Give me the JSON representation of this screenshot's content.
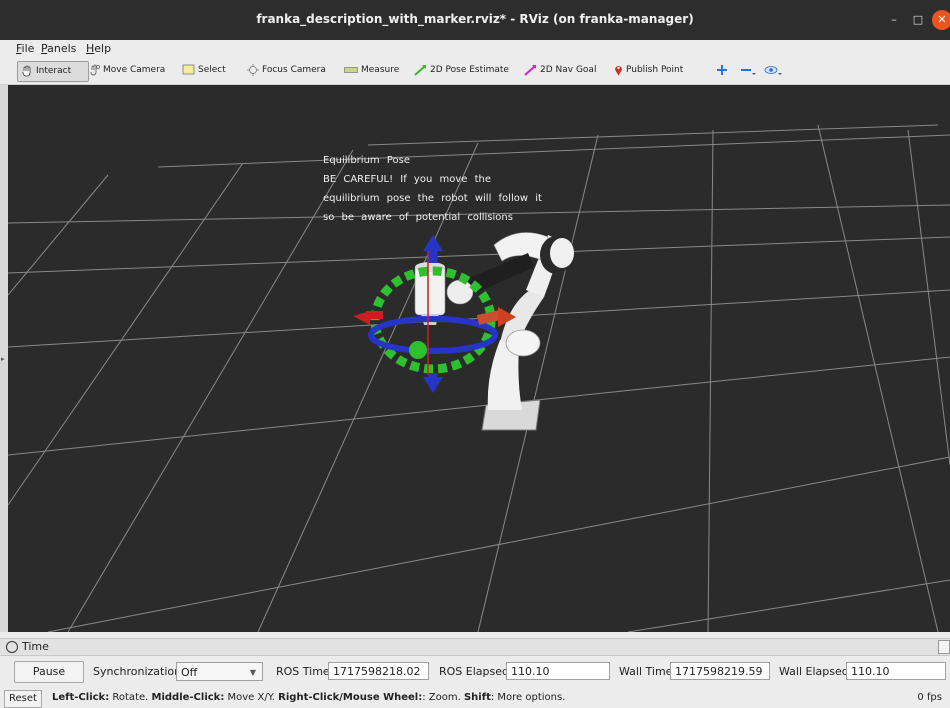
{
  "window": {
    "title": "franka_description_with_marker.rviz* - RViz (on franka-manager)",
    "minimize": "–",
    "maximize": "□",
    "close": "✕"
  },
  "menu": {
    "file": "File",
    "panels": "Panels",
    "help": "Help"
  },
  "toolbar": {
    "interact": "Interact",
    "move_camera": "Move Camera",
    "select": "Select",
    "focus_camera": "Focus Camera",
    "measure": "Measure",
    "pose_estimate": "2D Pose Estimate",
    "nav_goal": "2D Nav Goal",
    "publish_point": "Publish Point"
  },
  "viewport": {
    "marker_lines": [
      "Equilibrium Pose",
      "BE CAREFUL! If you move the",
      "equilibrium pose the robot will follow it",
      "so be aware of potential collisions"
    ]
  },
  "time_panel": {
    "title": "Time",
    "pause_label": "Pause",
    "sync_label": "Synchronization:",
    "sync_value": "Off",
    "ros_time_label": "ROS Time:",
    "ros_time_value": "1717598218.02",
    "ros_elapsed_label": "ROS Elapsed:",
    "ros_elapsed_value": "110.10",
    "wall_time_label": "Wall Time:",
    "wall_time_value": "1717598219.59",
    "wall_elapsed_label": "Wall Elapsed:",
    "wall_elapsed_value": "110.10"
  },
  "status": {
    "reset": "Reset",
    "hint_left_b": "Left-Click:",
    "hint_left": " Rotate. ",
    "hint_middle_b": "Middle-Click:",
    "hint_middle": " Move X/Y. ",
    "hint_right_b": "Right-Click/Mouse Wheel:",
    "hint_right": ": Zoom. ",
    "hint_shift_b": "Shift",
    "hint_shift": ": More options.",
    "fps": "0 fps"
  }
}
